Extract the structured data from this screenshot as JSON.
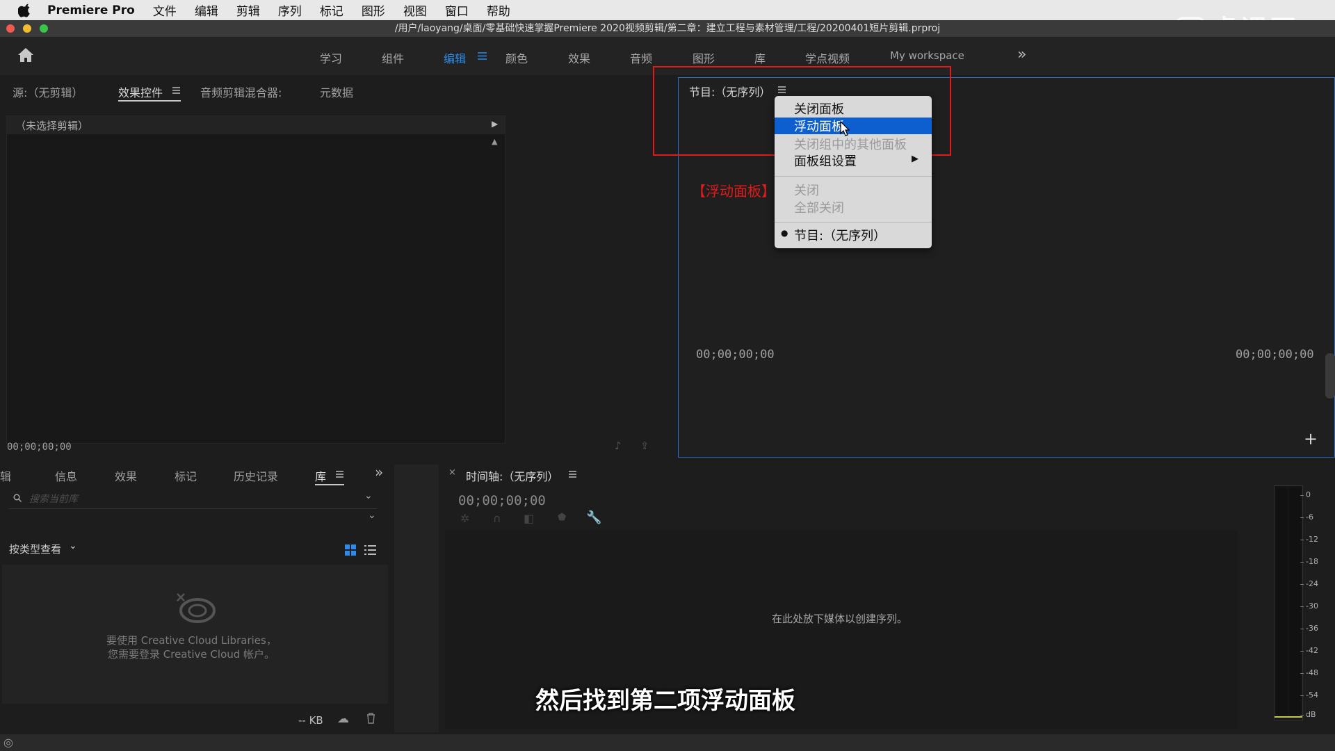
{
  "menubar": {
    "app_name": "Premiere Pro",
    "items": [
      "文件",
      "编辑",
      "剪辑",
      "序列",
      "标记",
      "图形",
      "视图",
      "窗口",
      "帮助"
    ]
  },
  "titlebar": {
    "path": "/用户/laoyang/桌面/零基础快速掌握Premiere 2020视频剪辑/第二章：建立工程与素材管理/工程/20200401短片剪辑.prproj"
  },
  "watermark": "虎课网",
  "workspaces": {
    "items": [
      "学习",
      "组件",
      "编辑",
      "颜色",
      "效果",
      "音频",
      "图形",
      "库",
      "学点视频",
      "My workspace"
    ],
    "active": "编辑"
  },
  "source_panel": {
    "tabs": [
      "源:（无剪辑）",
      "效果控件",
      "音频剪辑混合器:",
      "元数据"
    ],
    "active_tab": "效果控件",
    "no_clip": "（未选择剪辑）",
    "timecode": "00;00;00;00"
  },
  "program_panel": {
    "title": "节目:（无序列）",
    "timecode_left": "00;00;00;00",
    "timecode_right": "00;00;00;00",
    "annotation": "【浮动面板】"
  },
  "context_menu": {
    "items": [
      {
        "label": "关闭面板",
        "disabled": false
      },
      {
        "label": "浮动面板",
        "disabled": false,
        "highlighted": true
      },
      {
        "label": "关闭组中的其他面板",
        "disabled": true
      },
      {
        "label": "面板组设置",
        "disabled": false
      },
      {
        "label": "关闭",
        "disabled": true
      },
      {
        "label": "全部关闭",
        "disabled": true
      },
      {
        "label": "节目:（无序列）",
        "disabled": false,
        "checked": true
      }
    ]
  },
  "project_panel": {
    "tabs": [
      "剪辑",
      "信息",
      "效果",
      "标记",
      "历史记录",
      "库"
    ],
    "active_tab": "库",
    "search_placeholder": "搜索当前库",
    "view_by": "按类型查看",
    "cc_message_line1": "要使用 Creative Cloud Libraries，",
    "cc_message_line2": "您需要登录 Creative Cloud 帐户。",
    "size": "-- KB"
  },
  "timeline": {
    "title": "时间轴:（无序列）",
    "timecode": "00;00;00;00",
    "drop_hint": "在此处放下媒体以创建序列。"
  },
  "audio_meter": {
    "ticks": [
      "0",
      "-6",
      "-12",
      "-18",
      "-24",
      "-30",
      "-36",
      "-42",
      "-48",
      "-54",
      "dB"
    ]
  },
  "subtitle": "然后找到第二项浮动面板",
  "colors": {
    "accent": "#2d8ceb",
    "highlight": "#0d5ecf",
    "annotation_red": "#e21a1a"
  }
}
